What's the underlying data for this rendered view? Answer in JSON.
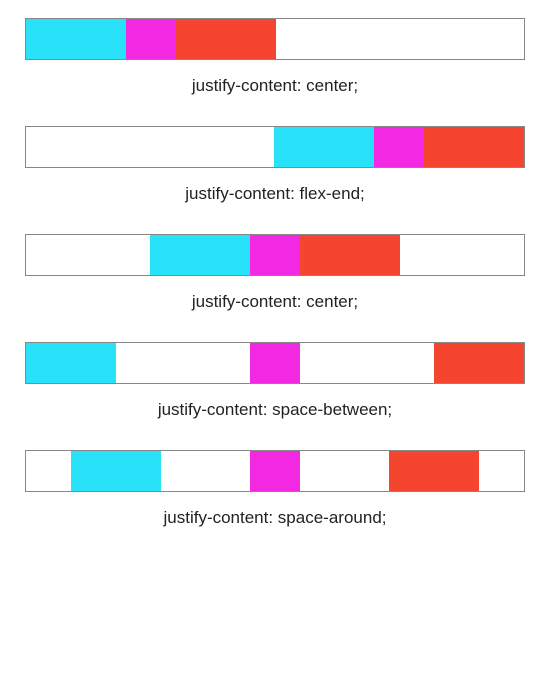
{
  "colors": {
    "cyan": "#28e2fa",
    "magenta": "#f328e3",
    "red": "#f5452f"
  },
  "examples": [
    {
      "mode": "flex-start",
      "modeClass": "start",
      "caption": "justify-content: center;",
      "boxes": [
        {
          "color": "cyan",
          "width": "lg"
        },
        {
          "color": "magenta",
          "width": "sm"
        },
        {
          "color": "red",
          "width": "lg"
        }
      ]
    },
    {
      "mode": "flex-end",
      "modeClass": "end",
      "caption": "justify-content: flex-end;",
      "boxes": [
        {
          "color": "cyan",
          "width": "lg"
        },
        {
          "color": "magenta",
          "width": "sm"
        },
        {
          "color": "red",
          "width": "lg"
        }
      ]
    },
    {
      "mode": "center",
      "modeClass": "center",
      "caption": "justify-content: center;",
      "boxes": [
        {
          "color": "cyan",
          "width": "lg"
        },
        {
          "color": "magenta",
          "width": "sm"
        },
        {
          "color": "red",
          "width": "lg"
        }
      ]
    },
    {
      "mode": "space-between",
      "modeClass": "between",
      "caption": "justify-content: space-between;",
      "boxes": [
        {
          "color": "cyan",
          "width": "md"
        },
        {
          "color": "magenta",
          "width": "sm"
        },
        {
          "color": "red",
          "width": "md"
        }
      ]
    },
    {
      "mode": "space-around",
      "modeClass": "around",
      "caption": "justify-content: space-around;",
      "boxes": [
        {
          "color": "cyan",
          "width": "md"
        },
        {
          "color": "magenta",
          "width": "sm"
        },
        {
          "color": "red",
          "width": "md"
        }
      ]
    }
  ]
}
